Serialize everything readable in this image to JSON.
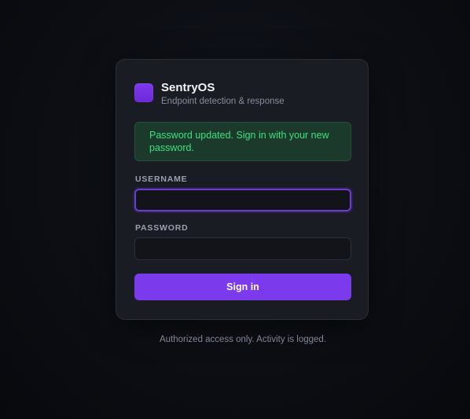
{
  "brand": {
    "name": "SentryOS",
    "subtitle": "Endpoint detection & response",
    "logo_color": "#7c3aed"
  },
  "alert": {
    "message": "Password updated. Sign in with your new password.",
    "color": "#3ee07e"
  },
  "form": {
    "username_label": "USERNAME",
    "username_value": "",
    "password_label": "PASSWORD",
    "password_value": "",
    "submit_label": "Sign in"
  },
  "footer": {
    "text": "Authorized access only. Activity is logged."
  },
  "colors": {
    "accent": "#7c3aed",
    "card": "#191c23",
    "background": "#0c0e14"
  }
}
